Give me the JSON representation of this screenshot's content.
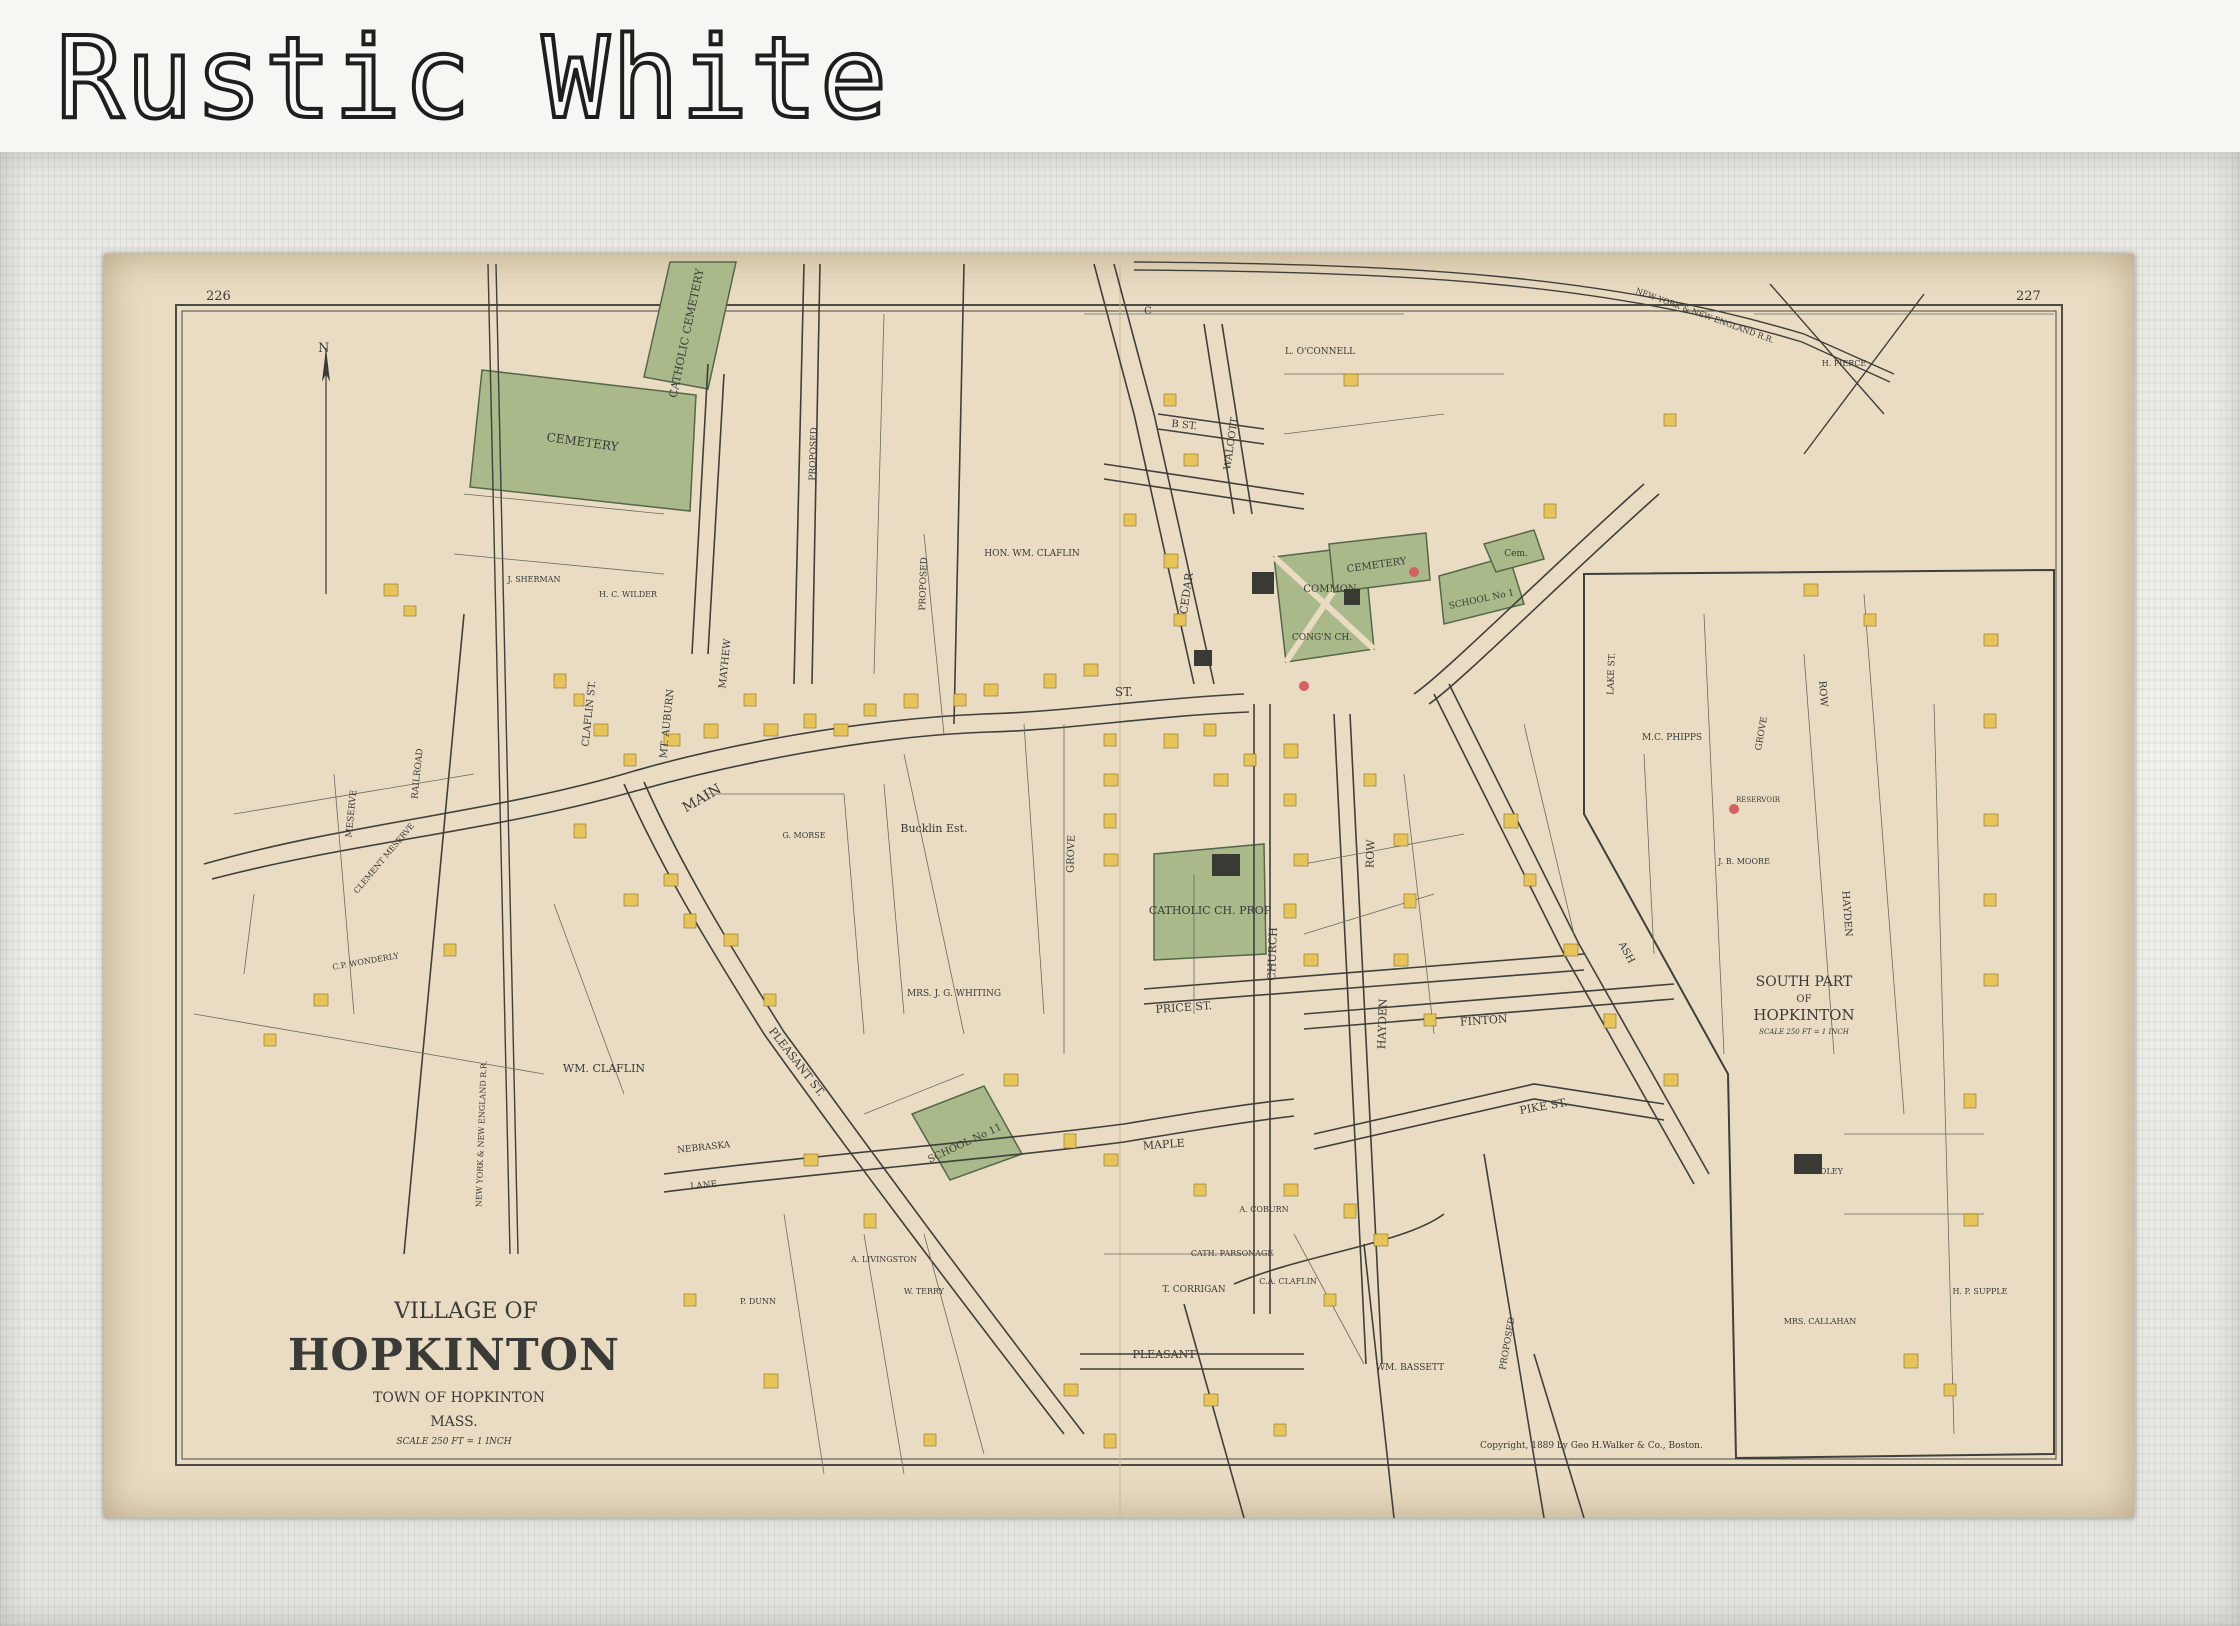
{
  "header": {
    "title": "Rustic White"
  },
  "map": {
    "page_left": "226",
    "page_right": "227",
    "north": "N",
    "title": {
      "village_of": "VILLAGE OF",
      "name": "HOPKINTON",
      "town": "TOWN OF HOPKINTON",
      "state": "MASS.",
      "scale": "SCALE 250 FT = 1 INCH"
    },
    "inset": {
      "title1": "SOUTH PART",
      "title2": "OF",
      "title3": "HOPKINTON",
      "scale": "SCALE 250 FT = 1 INCH"
    },
    "copyright": "Copyright, 1889 by Geo H.Walker & Co., Boston.",
    "labels": {
      "cemetery": "CEMETERY",
      "catholic_cemetery": "CATHOLIC CEMETERY",
      "cemetery_2": "CEMETERY",
      "common": "COMMON",
      "catholic_ch_prop": "CATHOLIC CH. PROP",
      "school_11": "SCHOOL No 11",
      "school_1": "SCHOOL No 1",
      "cem": "Cem.",
      "cong_ch": "CONG'N CH.",
      "main": "MAIN",
      "st": "ST.",
      "pleasant_st": "PLEASANT ST.",
      "pleasant_st_2": "PLEASANT",
      "maple_st": "MAPLE",
      "price_st": "PRICE ST.",
      "pike_st": "PIKE ST.",
      "finton_st": "FINTON",
      "nebraska_st": "NEBRASKA",
      "lane": "LANE",
      "church_st": "CHURCH",
      "hayden_row": "HAYDEN",
      "row": "ROW",
      "cedar_st": "CEDAR",
      "wachusett": "WALCOTT",
      "grove_st": "GROVE",
      "ash_st": "ASH",
      "mt_auburn": "MT. AUBURN",
      "mayhew_st": "MAYHEW",
      "claflin_st": "CLAFLIN ST.",
      "railroad": "RAILROAD",
      "meserve": "MESERVE",
      "proposed": "PROPOSED",
      "proposed_2": "PROPOSED",
      "proposed_3": "PROPOSED",
      "b_st": "B ST.",
      "c_st": "C",
      "lake_st": "LAKE ST.",
      "grove_south": "GROVE",
      "hayden_south": "HAYDEN",
      "row_south": "ROW",
      "ny_ne_rr": "NEW YORK & NEW ENGLAND R.R.",
      "ny_ne_rr_2": "NEW YORK & NEW ENGLAND R.R.",
      "buckling_est": "Bucklin Est.",
      "wm_claflin": "WM. CLAFLIN",
      "hon_wm_claflin": "HON. WM. CLAFLIN",
      "mrs_jg_whiting": "MRS. J. G. WHITING",
      "t_corrigan": "T. CORRIGAN",
      "wm_bassett": "WM. BASSETT",
      "l_oconnell": "L. O'CONNELL",
      "hc_wilder": "H. C. WILDER",
      "j_sherman": "J. SHERMAN",
      "g_morse": "G. MORSE",
      "a_coburn": "A. COBURN",
      "ca_claflin": "C.A. CLAFLIN",
      "cath_parsonage": "CATH. PARSONAGE",
      "mc_phipps": "M.C. PHIPPS",
      "jb_moore": "J. B. MOORE",
      "a_livingston": "A. LIVINGSTON",
      "w_terry": "W. TERRY",
      "p_dunn": "P. DUNN",
      "cp_wonderly": "C.P. WONDERLY",
      "clement_meserve": "CLEMENT MESERVE",
      "reservoir": "RESERVOIR",
      "h_pierce": "H. PIERCE",
      "mrs_callahan": "MRS. CALLAHAN",
      "hp_supple": "H. P. SUPPLE",
      "m_foley": "M. FOLEY"
    }
  },
  "colors": {
    "paper": "#e9dcc2",
    "green": "#a9b98a",
    "building": "#e7c45a",
    "ink": "#3a3a38"
  }
}
